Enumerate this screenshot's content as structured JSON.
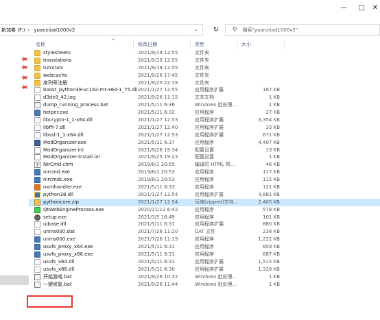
{
  "window": {
    "controls": {
      "minimize": "—",
      "maximize": "□",
      "close": "✕"
    }
  },
  "address": {
    "segments": [
      "新加卷 (F:)",
      "yuanziiad1000v2"
    ],
    "separator": "›",
    "dropdown": "⌄",
    "refresh": "↻"
  },
  "search": {
    "placeholder": "搜索\"yuanziiad1000v2\""
  },
  "columns": {
    "name": "名称",
    "date": "修改日期",
    "type": "类型",
    "size": "大小",
    "sort_arrow": "^"
  },
  "files": [
    {
      "name": "stylesheets",
      "date": "2021/9/19 12:55",
      "type": "文件夹",
      "size": "",
      "icon": "folder-icon"
    },
    {
      "name": "translations",
      "date": "2021/9/19 12:55",
      "type": "文件夹",
      "size": "",
      "icon": "folder-icon"
    },
    {
      "name": "tutorials",
      "date": "2021/9/19 12:55",
      "type": "文件夹",
      "size": "",
      "icon": "folder-icon"
    },
    {
      "name": "webcache",
      "date": "2021/9/26 17:45",
      "type": "文件夹",
      "size": "",
      "icon": "folder-icon"
    },
    {
      "name": "序列号注册",
      "date": "2021/9/25 22:19",
      "type": "文件夹",
      "size": "",
      "icon": "folder-icon"
    },
    {
      "name": "boost_python38-vc142-mt-x64-1_75.dll",
      "date": "2021/1/27 12:55",
      "type": "应用程序扩展",
      "size": "187 KB",
      "icon": "dll-icon"
    },
    {
      "name": "d3dx9_42.log",
      "date": "2021/9/26 11:15",
      "type": "文本文档",
      "size": "1 KB",
      "icon": "text-file-icon"
    },
    {
      "name": "dump_running_process.bat",
      "date": "2021/5/11 6:36",
      "type": "Windows 批处理...",
      "size": "1 KB",
      "icon": "batch-file-icon"
    },
    {
      "name": "helper.exe",
      "date": "2021/5/11 6:32",
      "type": "应用程序",
      "size": "27 KB",
      "icon": "exe-icon"
    },
    {
      "name": "libcrypto-1_1-x64.dll",
      "date": "2021/1/27 12:53",
      "type": "应用程序扩展",
      "size": "3,354 KB",
      "icon": "dll-icon"
    },
    {
      "name": "libffi-7.dll",
      "date": "2021/1/27 12:40",
      "type": "应用程序扩展",
      "size": "33 KB",
      "icon": "dll-icon"
    },
    {
      "name": "libssl-1_1-x64.dll",
      "date": "2021/1/27 12:53",
      "type": "应用程序扩展",
      "size": "671 KB",
      "icon": "dll-icon"
    },
    {
      "name": "ModOrganizer.exe",
      "date": "2021/5/11 6:37",
      "type": "应用程序",
      "size": "4,407 KB",
      "icon": "mod-organizer-icon"
    },
    {
      "name": "ModOrganizer.ini",
      "date": "2021/9/26 19:34",
      "type": "配置设置",
      "size": "13 KB",
      "icon": "ini-file-icon"
    },
    {
      "name": "ModOrganizer-install.ini",
      "date": "2021/9/25 19:23",
      "type": "配置设置",
      "size": "1 KB",
      "icon": "ini-file-icon"
    },
    {
      "name": "NirCmd.chm",
      "date": "2019/8/1 20:55",
      "type": "编译的 HTML 帮...",
      "size": "46 KB",
      "icon": "help-file-icon"
    },
    {
      "name": "nircmd.exe",
      "date": "2019/8/1 20:53",
      "type": "应用程序",
      "size": "117 KB",
      "icon": "nircmd-icon"
    },
    {
      "name": "nircmdc.exe",
      "date": "2019/8/1 20:53",
      "type": "应用程序",
      "size": "115 KB",
      "icon": "nircmd-icon"
    },
    {
      "name": "nxmhandler.exe",
      "date": "2021/5/11 6:33",
      "type": "应用程序",
      "size": "121 KB",
      "icon": "nxm-handler-icon"
    },
    {
      "name": "python38.dll",
      "date": "2021/1/27 12:54",
      "type": "应用程序扩展",
      "size": "4,881 KB",
      "icon": "python-dll-icon"
    },
    {
      "name": "pythoncore.zip",
      "date": "2021/1/27 12:54",
      "type": "压缩(zipped)文件...",
      "size": "2,405 KB",
      "icon": "zip-icon",
      "selected": true
    },
    {
      "name": "QtWebEngineProcess.exe",
      "date": "2020/11/12 6:42",
      "type": "应用程序",
      "size": "578 KB",
      "icon": "qt-icon"
    },
    {
      "name": "setup.exe",
      "date": "2021/3/5 16:49",
      "type": "应用程序",
      "size": "101 KB",
      "icon": "setup-gear-icon"
    },
    {
      "name": "uibase.dll",
      "date": "2021/5/11 6:31",
      "type": "应用程序扩展",
      "size": "880 KB",
      "icon": "dll-icon"
    },
    {
      "name": "unins000.dat",
      "date": "2021/7/26 11:20",
      "type": "DAT 文件",
      "size": "238 KB",
      "icon": "dat-file-icon"
    },
    {
      "name": "unins000.exe",
      "date": "2021/7/26 11:19",
      "type": "应用程序",
      "size": "1,222 KB",
      "icon": "uninstaller-icon"
    },
    {
      "name": "usvfs_proxy_x64.exe",
      "date": "2021/5/11 6:31",
      "type": "应用程序",
      "size": "859 KB",
      "icon": "exe-icon"
    },
    {
      "name": "usvfs_proxy_x86.exe",
      "date": "2021/5/11 6:31",
      "type": "应用程序",
      "size": "687 KB",
      "icon": "exe-icon"
    },
    {
      "name": "usvfs_x64.dll",
      "date": "2021/5/11 6:31",
      "type": "应用程序扩展",
      "size": "1,515 KB",
      "icon": "dll-icon"
    },
    {
      "name": "usvfs_x86.dll",
      "date": "2021/5/11 6:30",
      "type": "应用程序扩展",
      "size": "1,328 KB",
      "icon": "dll-icon"
    },
    {
      "name": "开始游戏.bat",
      "date": "2021/9/26 10:32",
      "type": "Windows 批处理...",
      "size": "1 KB",
      "icon": "batch-file-icon",
      "highlighted": true
    },
    {
      "name": "一键修复.bat",
      "date": "2021/9/26 11:44",
      "type": "Windows 批处理...",
      "size": "1 KB",
      "icon": "batch-file-icon"
    }
  ],
  "colors": {
    "selection": "#cce8ff",
    "highlight_box": "#e8322b",
    "header_text": "#4d6082"
  }
}
